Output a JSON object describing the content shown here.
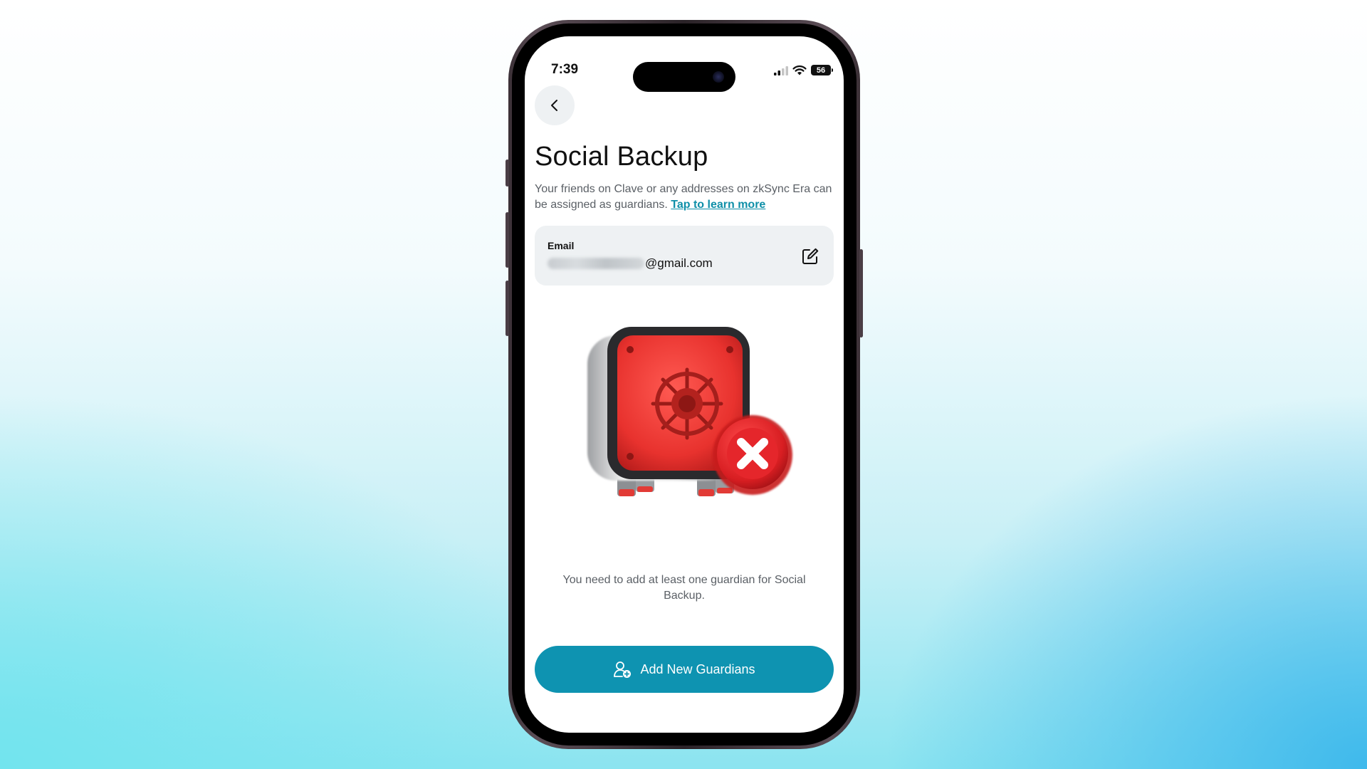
{
  "status_bar": {
    "time": "7:39",
    "battery": "56",
    "icons": [
      "cellular-signal-icon",
      "wifi-icon",
      "battery-icon"
    ]
  },
  "header": {
    "back_icon": "chevron-left-icon",
    "title": "Social Backup",
    "subtitle": "Your friends on Clave or any addresses on zkSync Era can be assigned as guardians.",
    "learn_more": "Tap to learn more"
  },
  "email_card": {
    "label": "Email",
    "value_suffix": "@gmail.com",
    "edit_icon": "edit-icon"
  },
  "illustration": {
    "icon": "locked-safe-error-icon"
  },
  "info": {
    "text": "You need to add at least one guardian for Social Backup."
  },
  "actions": {
    "add_guardians_label": "Add New Guardians",
    "add_guardians_icon": "add-user-icon"
  },
  "colors": {
    "accent": "#0e93b1",
    "link": "#0e8fa8",
    "card_bg": "#eef1f3",
    "safe_red": "#e8322e"
  }
}
